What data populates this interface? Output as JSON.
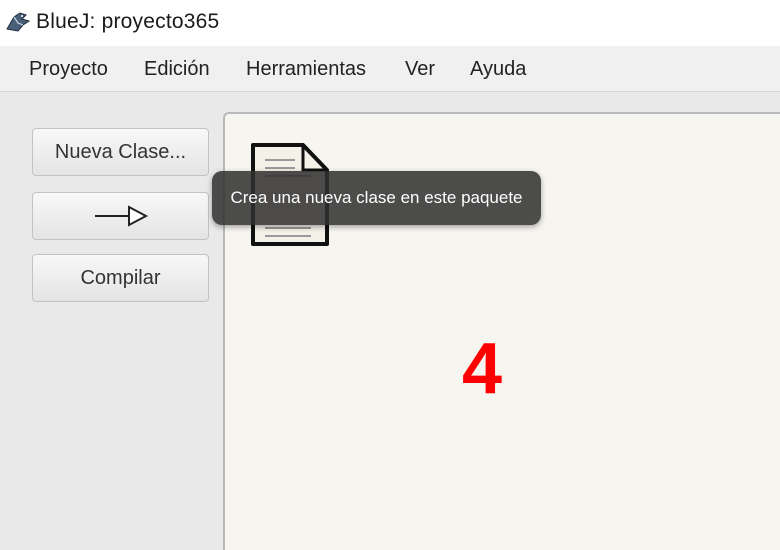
{
  "window": {
    "title": "BlueJ: proyecto365",
    "app_icon": "bluej-bird-icon"
  },
  "menubar": {
    "items": [
      "Proyecto",
      "Edición",
      "Herramientas",
      "Ver",
      "Ayuda"
    ]
  },
  "toolbar": {
    "new_class_label": "Nueva Clase...",
    "inheritance_arrow_icon": "inheritance-arrow-icon",
    "compile_label": "Compilar"
  },
  "canvas": {
    "class_icon": "document-icon",
    "tooltip": "Crea una nueva clase en este paquete",
    "overlay_number": "4"
  },
  "colors": {
    "overlay_number": "#ff0000",
    "canvas_bg": "#f7f5f0",
    "tooltip_bg": "#303030"
  }
}
